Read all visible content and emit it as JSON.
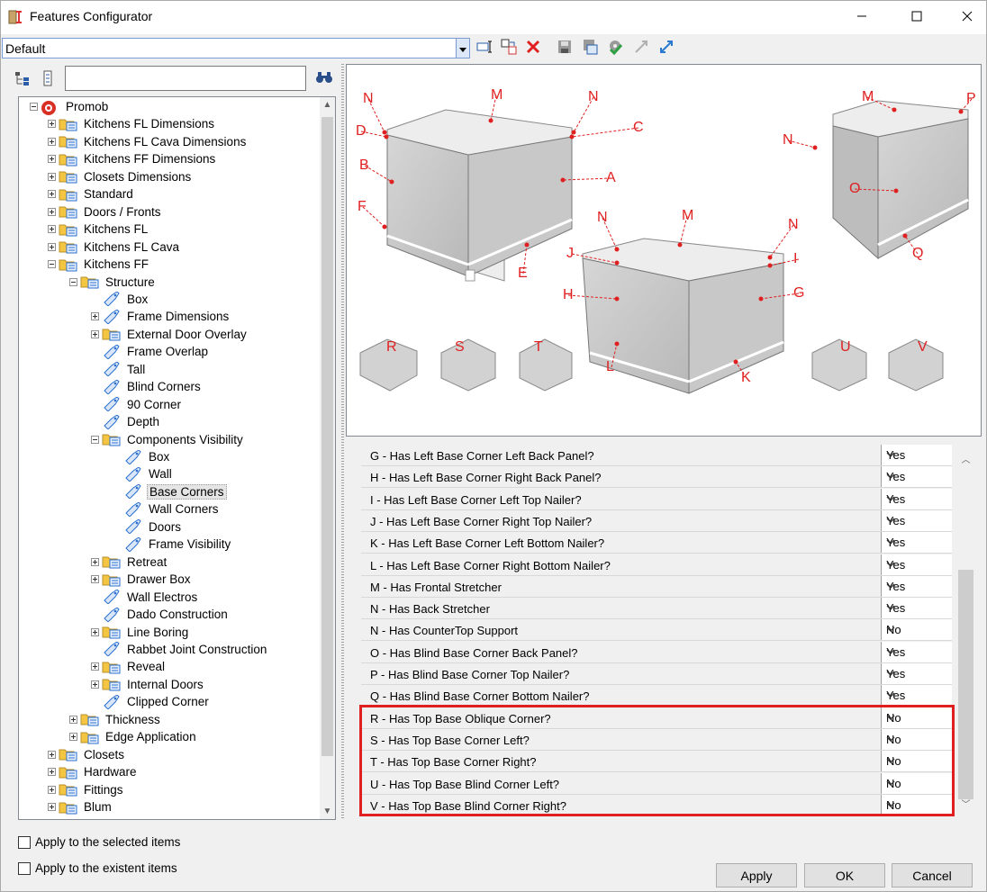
{
  "window": {
    "title": "Features Configurator",
    "minimize_icon": "minimize-icon",
    "maximize_icon": "maximize-icon",
    "close_icon": "close-icon"
  },
  "toolbar": {
    "preset_value": "Default",
    "icons": [
      "rename-icon",
      "move-icon",
      "delete-icon",
      "save-icon",
      "export-icon",
      "settings-icon",
      "collapse-icon",
      "expand-icon"
    ]
  },
  "tree": {
    "search_value": "",
    "items": [
      {
        "label": "Promob",
        "level": 0,
        "exp": "minus",
        "icon": "promob"
      },
      {
        "label": "Kitchens FL Dimensions",
        "level": 1,
        "exp": "plus",
        "icon": "folder"
      },
      {
        "label": "Kitchens FL Cava Dimensions",
        "level": 1,
        "exp": "plus",
        "icon": "folder"
      },
      {
        "label": "Kitchens FF Dimensions",
        "level": 1,
        "exp": "plus",
        "icon": "folder"
      },
      {
        "label": "Closets Dimensions",
        "level": 1,
        "exp": "plus",
        "icon": "folder"
      },
      {
        "label": "Standard",
        "level": 1,
        "exp": "plus",
        "icon": "folder"
      },
      {
        "label": "Doors / Fronts",
        "level": 1,
        "exp": "plus",
        "icon": "folder"
      },
      {
        "label": "Kitchens FL",
        "level": 1,
        "exp": "plus",
        "icon": "folder"
      },
      {
        "label": "Kitchens FL Cava",
        "level": 1,
        "exp": "plus",
        "icon": "folder"
      },
      {
        "label": "Kitchens FF",
        "level": 1,
        "exp": "minus",
        "icon": "folder"
      },
      {
        "label": "Structure",
        "level": 2,
        "exp": "minus",
        "icon": "folder"
      },
      {
        "label": "Box",
        "level": 3,
        "exp": "none",
        "icon": "tag"
      },
      {
        "label": "Frame Dimensions",
        "level": 3,
        "exp": "plus",
        "icon": "tag"
      },
      {
        "label": "External Door Overlay",
        "level": 3,
        "exp": "plus",
        "icon": "folder"
      },
      {
        "label": "Frame Overlap",
        "level": 3,
        "exp": "none",
        "icon": "tag"
      },
      {
        "label": "Tall",
        "level": 3,
        "exp": "none",
        "icon": "tag"
      },
      {
        "label": "Blind Corners",
        "level": 3,
        "exp": "none",
        "icon": "tag"
      },
      {
        "label": "90 Corner",
        "level": 3,
        "exp": "none",
        "icon": "tag"
      },
      {
        "label": "Depth",
        "level": 3,
        "exp": "none",
        "icon": "tag"
      },
      {
        "label": "Components Visibility",
        "level": 3,
        "exp": "minus",
        "icon": "folder"
      },
      {
        "label": "Box",
        "level": 4,
        "exp": "none",
        "icon": "tag"
      },
      {
        "label": "Wall",
        "level": 4,
        "exp": "none",
        "icon": "tag"
      },
      {
        "label": "Base Corners",
        "level": 4,
        "exp": "none",
        "icon": "tag",
        "selected": true
      },
      {
        "label": "Wall Corners",
        "level": 4,
        "exp": "none",
        "icon": "tag"
      },
      {
        "label": "Doors",
        "level": 4,
        "exp": "none",
        "icon": "tag"
      },
      {
        "label": "Frame Visibility",
        "level": 4,
        "exp": "none",
        "icon": "tag"
      },
      {
        "label": "Retreat",
        "level": 3,
        "exp": "plus",
        "icon": "folder"
      },
      {
        "label": "Drawer Box",
        "level": 3,
        "exp": "plus",
        "icon": "folder"
      },
      {
        "label": "Wall Electros",
        "level": 3,
        "exp": "none",
        "icon": "tag"
      },
      {
        "label": "Dado Construction",
        "level": 3,
        "exp": "none",
        "icon": "tag"
      },
      {
        "label": "Line Boring",
        "level": 3,
        "exp": "plus",
        "icon": "folder"
      },
      {
        "label": "Rabbet Joint Construction",
        "level": 3,
        "exp": "none",
        "icon": "tag"
      },
      {
        "label": "Reveal",
        "level": 3,
        "exp": "plus",
        "icon": "folder"
      },
      {
        "label": "Internal Doors",
        "level": 3,
        "exp": "plus",
        "icon": "folder"
      },
      {
        "label": "Clipped Corner",
        "level": 3,
        "exp": "none",
        "icon": "tag"
      },
      {
        "label": "Thickness",
        "level": 2,
        "exp": "plus",
        "icon": "folder"
      },
      {
        "label": "Edge Application",
        "level": 2,
        "exp": "plus",
        "icon": "folder"
      },
      {
        "label": "Closets",
        "level": 1,
        "exp": "plus",
        "icon": "folder"
      },
      {
        "label": "Hardware",
        "level": 1,
        "exp": "plus",
        "icon": "folder"
      },
      {
        "label": "Fittings",
        "level": 1,
        "exp": "plus",
        "icon": "folder"
      },
      {
        "label": "Blum",
        "level": 1,
        "exp": "plus",
        "icon": "folder"
      }
    ]
  },
  "diagram": {
    "labels": [
      "N",
      "M",
      "N",
      "D",
      "C",
      "B",
      "A",
      "F",
      "E",
      "N",
      "M",
      "N",
      "J",
      "I",
      "H",
      "G",
      "L",
      "K",
      "M",
      "P",
      "N",
      "O",
      "Q",
      "R",
      "S",
      "T",
      "U",
      "V"
    ],
    "tiles": [
      "R",
      "S",
      "T",
      "U",
      "V"
    ]
  },
  "properties": {
    "rows": [
      {
        "label": "G - Has Left Base Corner Left Back Panel?",
        "value": "Yes"
      },
      {
        "label": "H - Has Left Base Corner Right Back Panel?",
        "value": "Yes"
      },
      {
        "label": "I - Has Left Base Corner Left Top Nailer?",
        "value": "Yes"
      },
      {
        "label": "J - Has Left Base Corner Right Top Nailer?",
        "value": "Yes"
      },
      {
        "label": "K - Has Left Base Corner Left Bottom Nailer?",
        "value": "Yes"
      },
      {
        "label": "L - Has Left Base Corner Right Bottom Nailer?",
        "value": "Yes"
      },
      {
        "label": "M - Has Frontal Stretcher",
        "value": "Yes"
      },
      {
        "label": "N - Has Back Stretcher",
        "value": "Yes"
      },
      {
        "label": "N - Has CounterTop Support",
        "value": "No"
      },
      {
        "label": "O - Has Blind Base Corner Back Panel?",
        "value": "Yes"
      },
      {
        "label": "P - Has Blind Base Corner Top Nailer?",
        "value": "Yes"
      },
      {
        "label": "Q - Has Blind Base Corner Bottom Nailer?",
        "value": "Yes"
      },
      {
        "label": "R - Has Top Base Oblique Corner?",
        "value": "No"
      },
      {
        "label": "S - Has Top Base Corner Left?",
        "value": "No"
      },
      {
        "label": "T - Has Top Base Corner Right?",
        "value": "No"
      },
      {
        "label": "U - Has Top Base Blind Corner Left?",
        "value": "No"
      },
      {
        "label": "V - Has Top Base Blind Corner Right?",
        "value": "No"
      }
    ]
  },
  "footer": {
    "apply_selected": "Apply to the selected items",
    "apply_existent": "Apply to the existent items",
    "apply_button": "Apply",
    "ok_button": "OK",
    "cancel_button": "Cancel"
  },
  "colors": {
    "highlight": "#e02020",
    "label_red": "#e02020",
    "folder": "#f4c542"
  }
}
